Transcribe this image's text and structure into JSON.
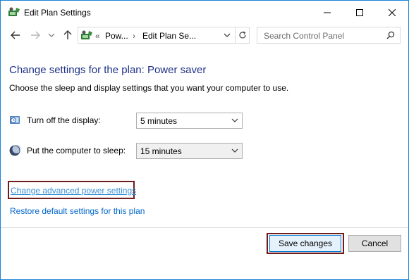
{
  "window": {
    "title": "Edit Plan Settings"
  },
  "navigation": {
    "breadcrumb_prefix": "«",
    "crumbs": [
      "Pow...",
      "Edit Plan Se..."
    ],
    "separator": "›"
  },
  "search": {
    "placeholder": "Search Control Panel"
  },
  "content": {
    "heading": "Change settings for the plan: Power saver",
    "description": "Choose the sleep and display settings that you want your computer to use.",
    "settings": [
      {
        "label": "Turn off the display:",
        "value": "5 minutes",
        "icon": "display-clock-icon"
      },
      {
        "label": "Put the computer to sleep:",
        "value": "15 minutes",
        "icon": "moon-icon"
      }
    ],
    "links": {
      "advanced": "Change advanced power settings",
      "restore": "Restore default settings for this plan"
    }
  },
  "buttons": {
    "save": "Save changes",
    "cancel": "Cancel"
  },
  "colors": {
    "heading": "#1e3287",
    "link": "#0066cc",
    "window_border": "#1883d7",
    "highlight_border": "#6e1c1c"
  }
}
